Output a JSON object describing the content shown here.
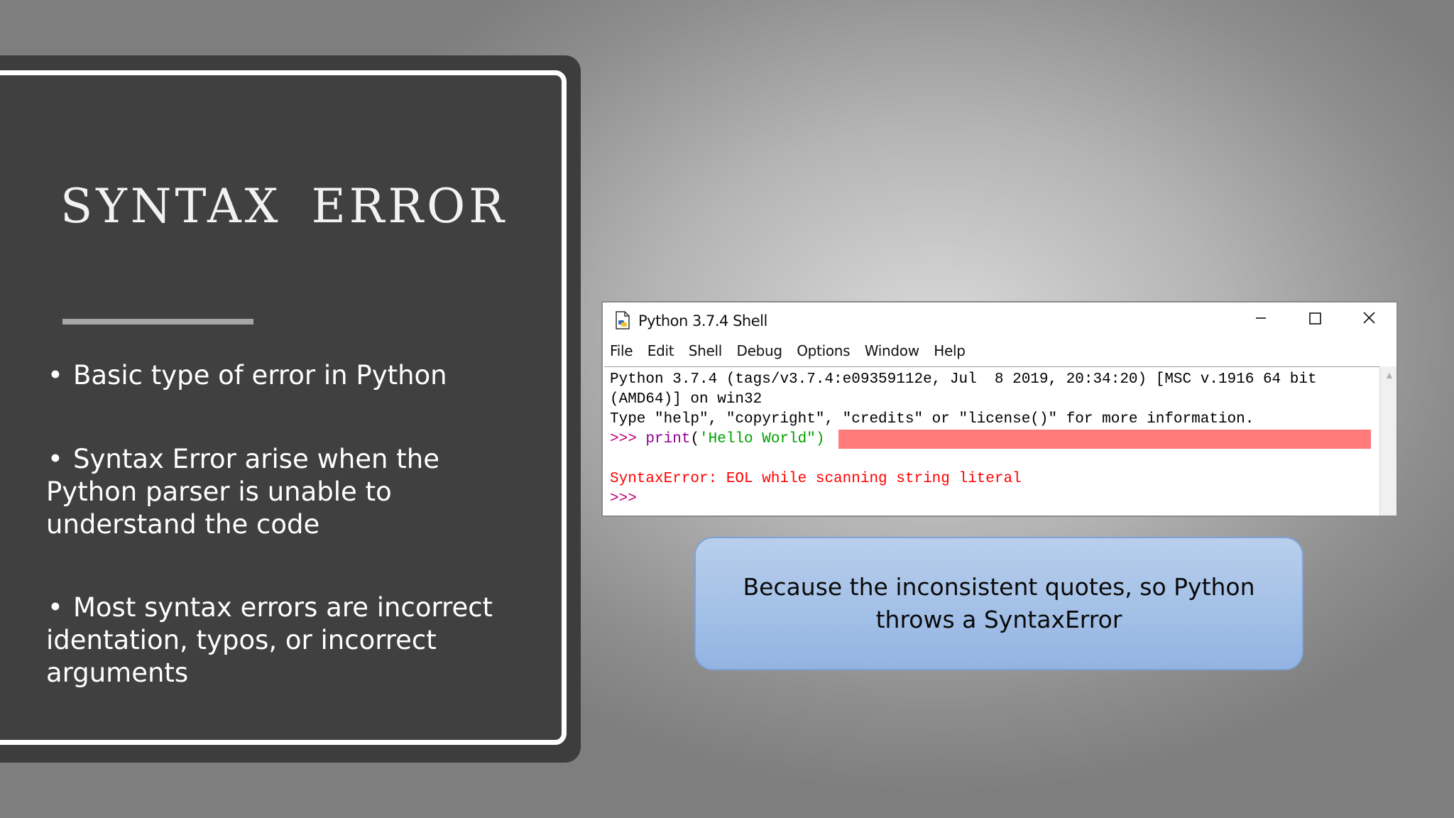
{
  "slide": {
    "title": "SYNTAX  ERROR",
    "bullets": [
      "Basic type of error in Python",
      "Syntax Error arise when the Python parser is unable to understand the code",
      "Most syntax errors are incorrect identation, typos, or incorrect arguments"
    ],
    "bullet_symbol": "•"
  },
  "shell": {
    "title": "Python 3.7.4 Shell",
    "menu": [
      "File",
      "Edit",
      "Shell",
      "Debug",
      "Options",
      "Window",
      "Help"
    ],
    "console": {
      "line1": "Python 3.7.4 (tags/v3.7.4:e09359112e, Jul  8 2019, 20:34:20) [MSC v.1916 64 bit",
      "line2": "(AMD64)] on win32",
      "line3": "Type \"help\", \"copyright\", \"credits\" or \"license()\" for more information.",
      "prompt": ">>> ",
      "code_func": "print",
      "code_open": "(",
      "code_string": "'Hello World\")",
      "error": "SyntaxError: EOL while scanning string literal",
      "last_prompt": ">>>"
    },
    "window_controls": [
      "minimize-icon",
      "maximize-icon",
      "close-icon"
    ]
  },
  "callout": {
    "text": "Because the inconsistent quotes, so Python throws a SyntaxError"
  },
  "colors": {
    "panel": "#404040",
    "error_highlight": "#ff7b7b",
    "callout_fill": "#a4c1e8"
  }
}
